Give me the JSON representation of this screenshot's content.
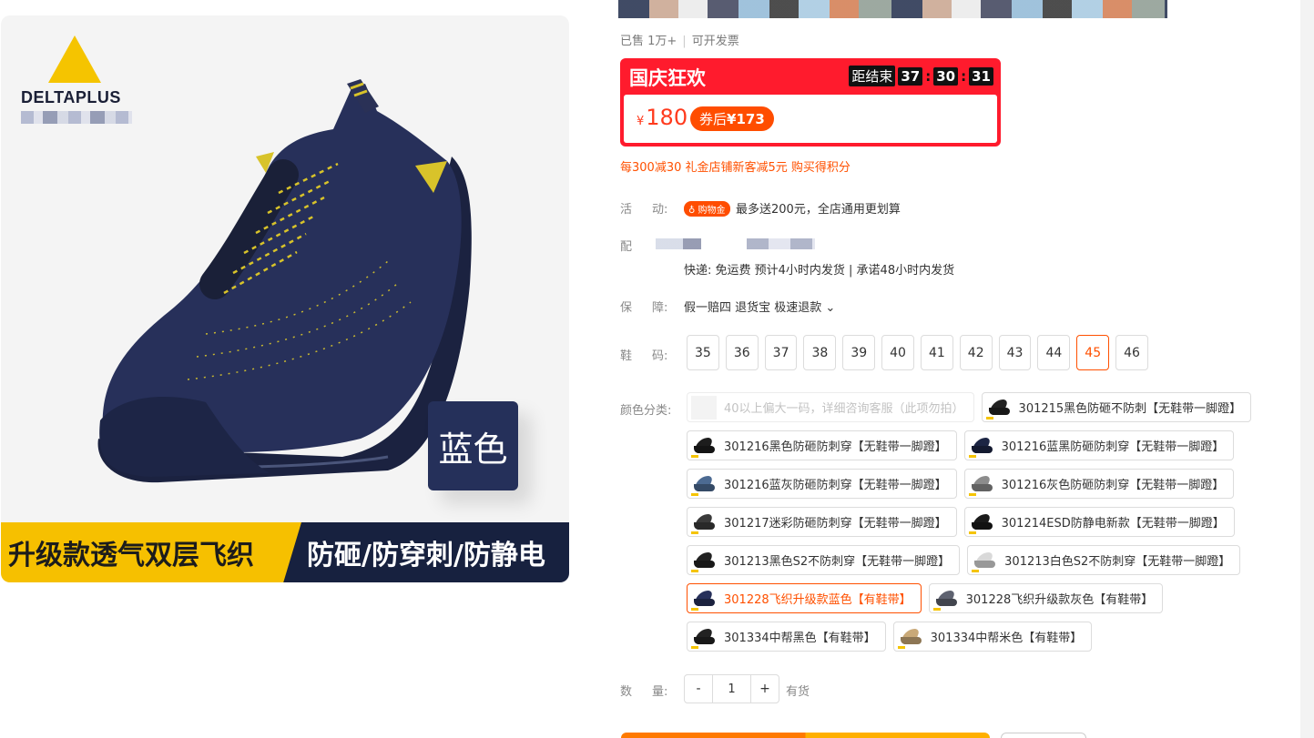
{
  "hero": {
    "brand_name": "DELTAPLUS",
    "color_badge": "蓝色",
    "banner_left": "升级款透气双层飞织",
    "banner_right": "防砸/防穿刺/防静电"
  },
  "sold": {
    "count": "已售 1万+",
    "invoice": "可开发票"
  },
  "promo": {
    "title": "国庆狂欢",
    "countdown_label": "距结束",
    "hours": "37",
    "minutes": "30",
    "seconds": "31",
    "currency": "¥",
    "price": "180",
    "coupon_label": "券后",
    "coupon_price": "¥173"
  },
  "offer_line": "每300减30 礼金店铺新客减5元 购买得积分",
  "activity": {
    "label_a": "活",
    "label_b": "动:",
    "tag": "购物金",
    "text": "最多送200元，全店通用更划算"
  },
  "shipping": {
    "label": "配",
    "text": "快递: 免运费   预计4小时内发货 | 承诺48小时内发货"
  },
  "guarantee": {
    "label_a": "保",
    "label_b": "障:",
    "text": "假一赔四 退货宝 极速退款",
    "chevron": "⌄"
  },
  "size": {
    "label_a": "鞋",
    "label_b": "码:",
    "options": [
      "35",
      "36",
      "37",
      "38",
      "39",
      "40",
      "41",
      "42",
      "43",
      "44",
      "45",
      "46"
    ],
    "selected": "45"
  },
  "color": {
    "label": "颜色分类:",
    "rows": [
      [
        {
          "text": "40以上偏大一码，详细咨询客服（此项勿拍）",
          "state": "disabled",
          "shoe": "none"
        },
        {
          "text": "301215黑色防砸不防刺【无鞋带一脚蹬】",
          "state": "normal",
          "shoe": "#222"
        }
      ],
      [
        {
          "text": "301216黑色防砸防刺穿【无鞋带一脚蹬】",
          "state": "normal",
          "shoe": "#1d1d1d"
        },
        {
          "text": "301216蓝黑防砸防刺穿【无鞋带一脚蹬】",
          "state": "normal",
          "shoe": "#1c2544"
        }
      ],
      [
        {
          "text": "301216蓝灰防砸防刺穿【无鞋带一脚蹬】",
          "state": "normal",
          "shoe": "#4c6a92"
        },
        {
          "text": "301216灰色防砸防刺穿【无鞋带一脚蹬】",
          "state": "normal",
          "shoe": "#8c8c8c"
        }
      ],
      [
        {
          "text": "301217迷彩防砸防刺穿【无鞋带一脚蹬】",
          "state": "normal",
          "shoe": "#3a3a3a"
        },
        {
          "text": "301214ESD防静电新款【无鞋带一脚蹬】",
          "state": "normal",
          "shoe": "#1a1a1a"
        }
      ],
      [
        {
          "text": "301213黑色S2不防刺穿【无鞋带一脚蹬】",
          "state": "normal",
          "shoe": "#222"
        },
        {
          "text": "301213白色S2不防刺穿【无鞋带一脚蹬】",
          "state": "normal",
          "shoe": "#d9d9d9"
        }
      ],
      [
        {
          "text": "301228飞织升级款蓝色【有鞋带】",
          "state": "selected",
          "shoe": "#27305a"
        },
        {
          "text": "301228飞织升级款灰色【有鞋带】",
          "state": "normal",
          "shoe": "#5e6270"
        }
      ],
      [
        {
          "text": "301334中帮黑色【有鞋带】",
          "state": "normal",
          "shoe": "#222"
        },
        {
          "text": "301334中帮米色【有鞋带】",
          "state": "normal",
          "shoe": "#c9a978"
        }
      ]
    ]
  },
  "quantity": {
    "label_a": "数",
    "label_b": "量:",
    "minus": "-",
    "value": "1",
    "plus": "+",
    "stock": "有货"
  },
  "colors": {
    "accent": "#ff5000",
    "promo_red": "#ff1b2d",
    "brand_yellow": "#f5c400",
    "navy": "#17213f"
  }
}
